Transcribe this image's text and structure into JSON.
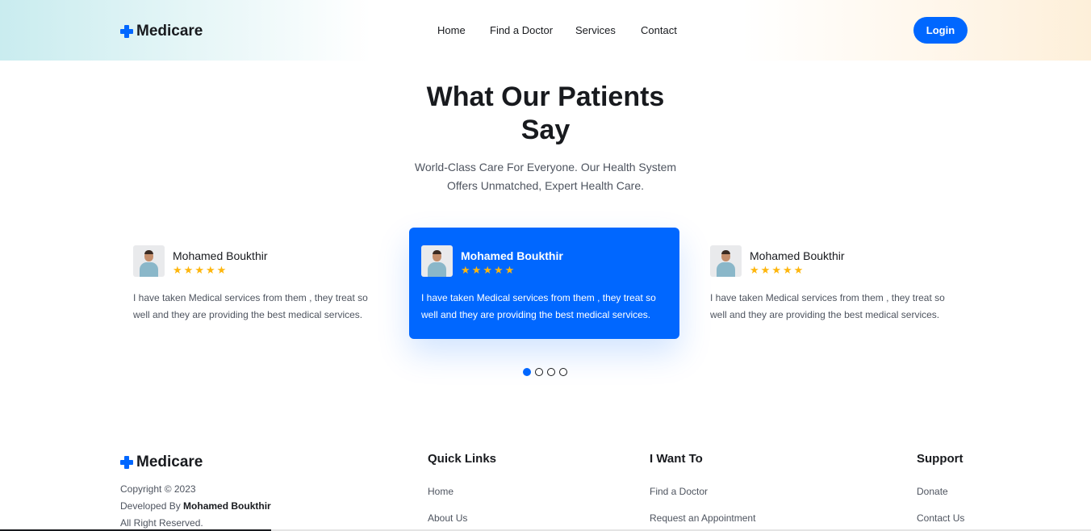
{
  "header": {
    "logo": "Medicare",
    "nav": [
      "Home",
      "Find a Doctor",
      "Services",
      "Contact"
    ],
    "login_label": "Login"
  },
  "testimonials": {
    "title_line1": "What Our Patients",
    "title_line2": "Say",
    "subtitle_line1": "World-Class Care For Everyone. Our Health System",
    "subtitle_line2": "Offers Unmatched, Expert Health Care.",
    "cards": [
      {
        "name": "Mohamed Boukthir",
        "rating": 5,
        "quote": "I have taken Medical services from them , they treat so well and they are providing the best medical services."
      },
      {
        "name": "Mohamed Boukthir",
        "rating": 5,
        "quote": "I have taken Medical services from them , they treat so well and they are providing the best medical services."
      },
      {
        "name": "Mohamed Boukthir",
        "rating": 5,
        "quote": "I have taken Medical services from them , they treat so well and they are providing the best medical services."
      }
    ],
    "active_dot": 0,
    "dot_count": 4
  },
  "footer": {
    "logo": "Medicare",
    "copyright": "Copyright © 2023",
    "developed_prefix": "Developed By ",
    "developer": "Mohamed Boukthir",
    "rights": "All Right Reserved.",
    "columns": [
      {
        "title": "Quick Links",
        "links": [
          "Home",
          "About Us"
        ]
      },
      {
        "title": "I Want To",
        "links": [
          "Find a Doctor",
          "Request an Appointment"
        ]
      },
      {
        "title": "Support",
        "links": [
          "Donate",
          "Contact Us"
        ]
      }
    ]
  },
  "colors": {
    "primary": "#0067ff",
    "star": "#feb60d",
    "heading": "#181a1e",
    "text": "#4e545f"
  }
}
